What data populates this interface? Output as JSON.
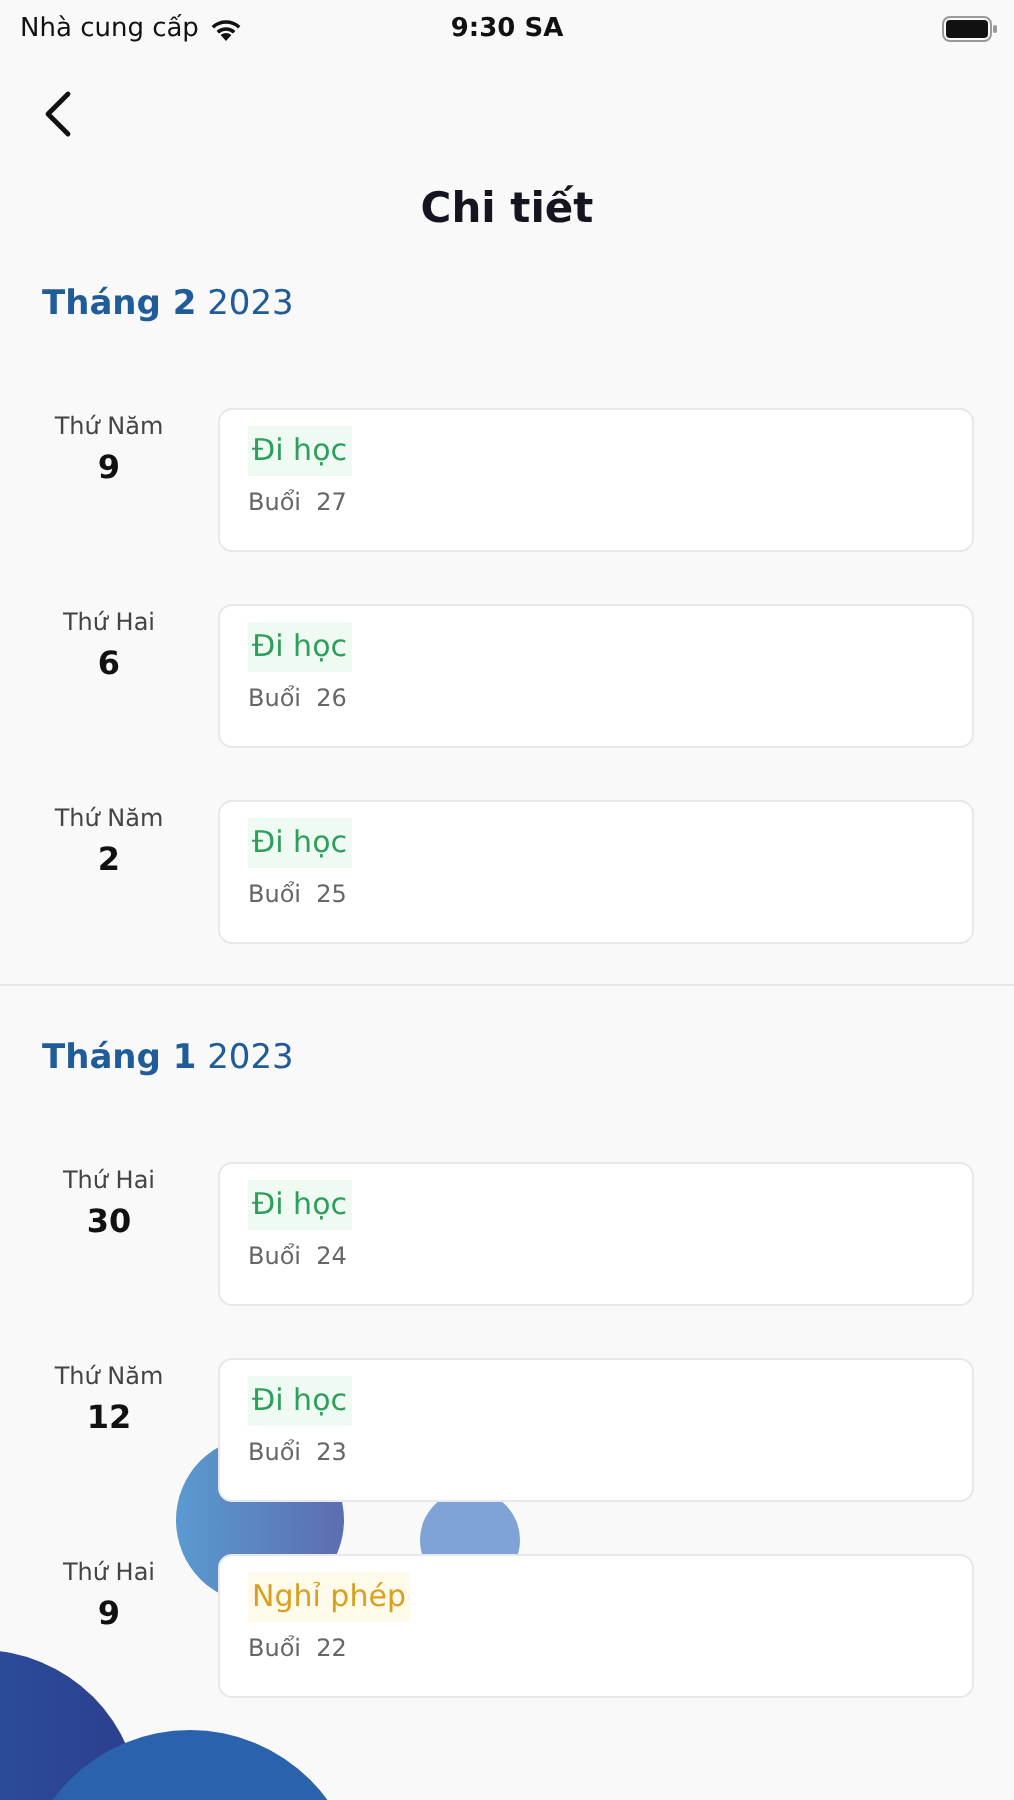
{
  "status_bar": {
    "carrier": "Nhà cung cấp",
    "time": "9:30 SA"
  },
  "title": "Chi tiết",
  "months": [
    {
      "month": "Tháng 2",
      "year": "2023",
      "entries": [
        {
          "weekday": "Thứ Năm",
          "day": "9",
          "status": {
            "kind": "present",
            "label": "Đi học"
          },
          "session": "Buổi  27"
        },
        {
          "weekday": "Thứ Hai",
          "day": "6",
          "status": {
            "kind": "present",
            "label": "Đi học"
          },
          "session": "Buổi  26"
        },
        {
          "weekday": "Thứ Năm",
          "day": "2",
          "status": {
            "kind": "present",
            "label": "Đi học"
          },
          "session": "Buổi  25"
        }
      ]
    },
    {
      "month": "Tháng 1",
      "year": "2023",
      "entries": [
        {
          "weekday": "Thứ Hai",
          "day": "30",
          "status": {
            "kind": "present",
            "label": "Đi học"
          },
          "session": "Buổi  24"
        },
        {
          "weekday": "Thứ Năm",
          "day": "12",
          "status": {
            "kind": "present",
            "label": "Đi học"
          },
          "session": "Buổi  23"
        },
        {
          "weekday": "Thứ Hai",
          "day": "9",
          "status": {
            "kind": "leave",
            "label": "Nghỉ phép"
          },
          "session": "Buổi  22"
        }
      ]
    }
  ]
}
